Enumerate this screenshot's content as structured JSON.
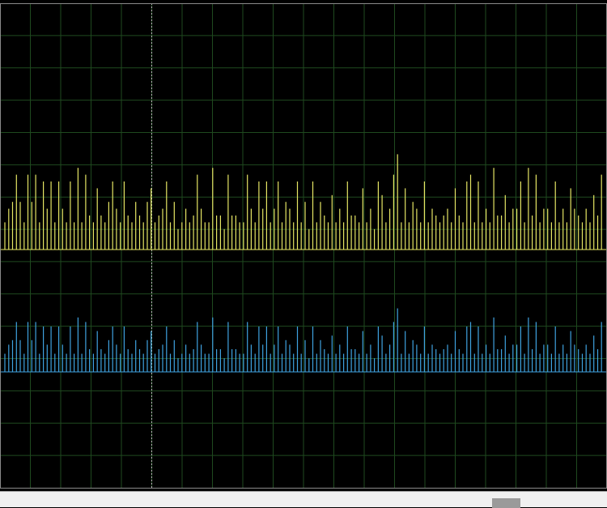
{
  "colors": {
    "background": "#000000",
    "grid": "#1f4a1f",
    "frame": "#8a8a8a",
    "cursor": "#b8b8b8",
    "channel_a": "#e6e664",
    "channel_b": "#3fa2e0",
    "statusbar": "#f0f0f0",
    "scroll_thumb": "#9a9a9a"
  },
  "display": {
    "grid_divisions_x": 20,
    "grid_divisions_y": 15,
    "cursor_division": 5
  },
  "chart_data": {
    "type": "bar",
    "x_range": [
      0,
      156
    ],
    "series": [
      {
        "values": [
          4,
          6,
          7,
          11,
          7,
          4,
          11,
          7,
          11,
          4,
          10,
          6,
          10,
          4,
          10,
          6,
          4,
          10,
          4,
          12,
          4,
          11,
          5,
          4,
          9,
          5,
          4,
          7,
          10,
          6,
          4,
          10,
          5,
          4,
          7,
          5,
          4,
          7,
          9,
          4,
          5,
          6,
          10,
          4,
          7,
          3,
          4,
          6,
          4,
          5,
          11,
          6,
          4,
          4,
          12,
          5,
          5,
          3,
          11,
          5,
          5,
          4,
          4,
          11,
          6,
          4,
          10,
          6,
          10,
          4,
          6,
          10,
          4,
          7,
          6,
          4,
          10,
          4,
          7,
          3,
          10,
          4,
          7,
          5,
          4,
          8,
          4,
          6,
          4,
          10,
          5,
          5,
          4,
          9,
          4,
          6,
          3,
          10,
          8,
          4,
          6,
          11,
          14,
          4,
          9,
          4,
          7,
          6,
          4,
          10,
          4,
          6,
          5,
          4,
          5,
          6,
          4,
          9,
          5,
          4,
          10,
          11,
          4,
          10,
          4,
          6,
          4,
          12,
          5,
          5,
          8,
          4,
          6,
          6,
          10,
          4,
          12,
          5,
          11,
          4,
          6,
          6,
          4,
          10,
          4,
          6,
          4,
          9,
          6,
          5,
          4,
          6,
          4,
          8,
          5,
          11
        ]
      },
      {
        "values": [
          4,
          6,
          7,
          11,
          7,
          4,
          11,
          7,
          11,
          4,
          10,
          6,
          10,
          4,
          10,
          6,
          4,
          10,
          4,
          12,
          4,
          11,
          5,
          4,
          9,
          5,
          4,
          7,
          10,
          6,
          4,
          10,
          5,
          4,
          7,
          5,
          4,
          7,
          9,
          4,
          5,
          6,
          10,
          4,
          7,
          3,
          4,
          6,
          4,
          5,
          11,
          6,
          4,
          4,
          12,
          5,
          5,
          3,
          11,
          5,
          5,
          4,
          4,
          11,
          6,
          4,
          10,
          6,
          10,
          4,
          6,
          10,
          4,
          7,
          6,
          4,
          10,
          4,
          7,
          3,
          10,
          4,
          7,
          5,
          4,
          8,
          4,
          6,
          4,
          10,
          5,
          5,
          4,
          9,
          4,
          6,
          3,
          10,
          8,
          4,
          6,
          11,
          14,
          4,
          9,
          4,
          7,
          6,
          4,
          10,
          4,
          6,
          5,
          4,
          5,
          6,
          4,
          9,
          5,
          4,
          10,
          11,
          4,
          10,
          4,
          6,
          4,
          12,
          5,
          5,
          8,
          4,
          6,
          6,
          10,
          4,
          12,
          5,
          11,
          4,
          6,
          6,
          4,
          10,
          4,
          6,
          4,
          9,
          6,
          5,
          4,
          6,
          4,
          8,
          5,
          11
        ]
      }
    ]
  }
}
